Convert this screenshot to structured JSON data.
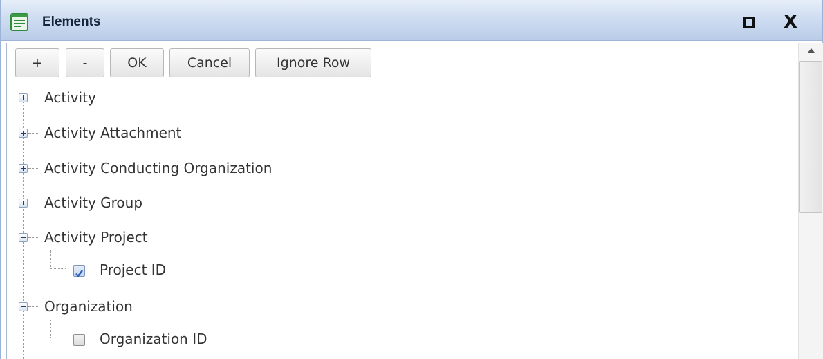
{
  "window": {
    "title": "Elements",
    "icon": "list-window-icon",
    "maximize_icon": "maximize-icon",
    "close_label": "X"
  },
  "toolbar": {
    "add_label": "+",
    "remove_label": "-",
    "ok_label": "OK",
    "cancel_label": "Cancel",
    "ignore_label": "Ignore Row"
  },
  "tree": {
    "nodes": [
      {
        "label": "Activity",
        "expanded": false
      },
      {
        "label": "Activity Attachment",
        "expanded": false
      },
      {
        "label": "Activity Conducting Organization",
        "expanded": false
      },
      {
        "label": "Activity Group",
        "expanded": false
      },
      {
        "label": "Activity Project",
        "expanded": true,
        "children": [
          {
            "label": "Project ID",
            "checked": true
          }
        ]
      },
      {
        "label": "Organization",
        "expanded": true,
        "children": [
          {
            "label": "Organization ID",
            "checked": false
          }
        ]
      }
    ]
  },
  "colors": {
    "titlebar": "#cfddf1",
    "checkbox_check": "#2c5fb8"
  }
}
